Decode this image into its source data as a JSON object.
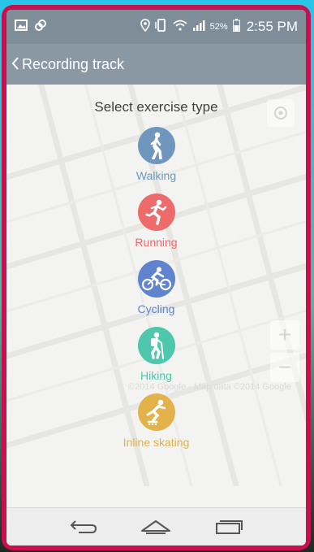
{
  "colors": {
    "statusbar": "#7e8d98",
    "actionbar": "#8a98a3",
    "device_frame": "#c8104e",
    "walking": "#6f96bd",
    "running": "#ee6b6b",
    "cycling": "#5f83cf",
    "hiking": "#4ec7ad",
    "inline_skating": "#e3b24a"
  },
  "status_bar": {
    "left_icons": [
      "image-icon",
      "link-icon"
    ],
    "right_icons": [
      "location-pin-icon",
      "phone-rotate-icon",
      "wifi-icon",
      "signal-icon",
      "battery-icon"
    ],
    "battery_percent": "52%",
    "time": "2:55 PM"
  },
  "action_bar": {
    "back_icon": "chevron-left-icon",
    "title": "Recording track"
  },
  "map": {
    "compass_icon": "compass-icon",
    "zoom_in": "+",
    "zoom_out": "−",
    "attribution": "©2014 Google - Map data ©2014 Google"
  },
  "content": {
    "heading": "Select exercise type",
    "exercises": [
      {
        "label": "Walking",
        "icon": "walking-icon"
      },
      {
        "label": "Running",
        "icon": "running-icon"
      },
      {
        "label": "Cycling",
        "icon": "cycling-icon"
      },
      {
        "label": "Hiking",
        "icon": "hiking-icon"
      },
      {
        "label": "Inline skating",
        "icon": "inline-skating-icon"
      }
    ]
  },
  "nav_bar": {
    "buttons": [
      "back-nav-icon",
      "home-icon",
      "recent-apps-icon"
    ]
  }
}
